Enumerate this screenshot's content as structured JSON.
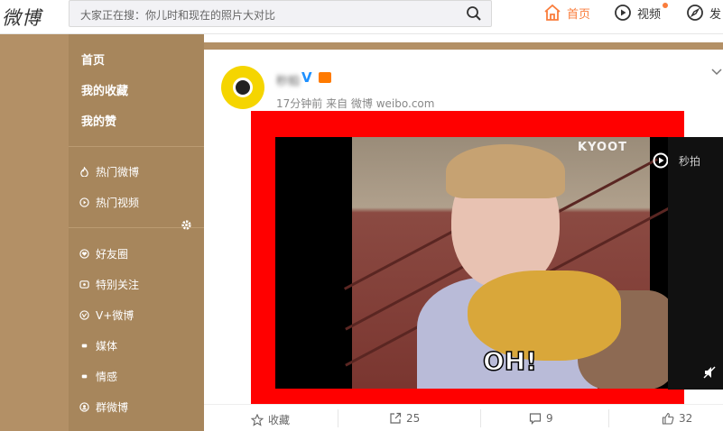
{
  "header": {
    "logo": "微博",
    "search_placeholder": "大家正在搜：你儿时和现在的照片大对比",
    "nav": [
      {
        "label": "首页",
        "icon": "home-icon",
        "active": true
      },
      {
        "label": "视频",
        "icon": "video-icon",
        "has_dot": true
      },
      {
        "label": "发",
        "icon": "compass-icon"
      }
    ]
  },
  "sidebar": {
    "primary": [
      "首页",
      "我的收藏",
      "我的赞"
    ],
    "groups": [
      {
        "label": "热门微博",
        "icon": "fire-icon"
      },
      {
        "label": "热门视频",
        "icon": "play-circle-icon"
      },
      {
        "label": "好友圈",
        "icon": "heart-icon"
      },
      {
        "label": "特别关注",
        "icon": "star-icon"
      },
      {
        "label": "V+微博",
        "icon": "v-plus-icon"
      },
      {
        "label": "媒体",
        "icon": "bullet-icon"
      },
      {
        "label": "情感",
        "icon": "bullet-icon"
      },
      {
        "label": "群微博",
        "icon": "group-icon"
      }
    ]
  },
  "post": {
    "username": "秒拍",
    "time": "17分钟前",
    "source": "来自 微博 weibo.com",
    "video": {
      "caption": "OH!",
      "watermark": "KYOOT",
      "side_text": "秒拍"
    },
    "actions": [
      {
        "label": "收藏",
        "icon": "star-outline-icon"
      },
      {
        "label": "25",
        "icon": "share-icon"
      },
      {
        "label": "9",
        "icon": "comment-icon"
      },
      {
        "label": "32",
        "icon": "thumbs-up-icon"
      }
    ]
  },
  "colors": {
    "accent": "#fa7d3c",
    "sidebar_bg": "#a7865c",
    "page_bg": "#b39066",
    "highlight_frame": "#ff0000"
  }
}
